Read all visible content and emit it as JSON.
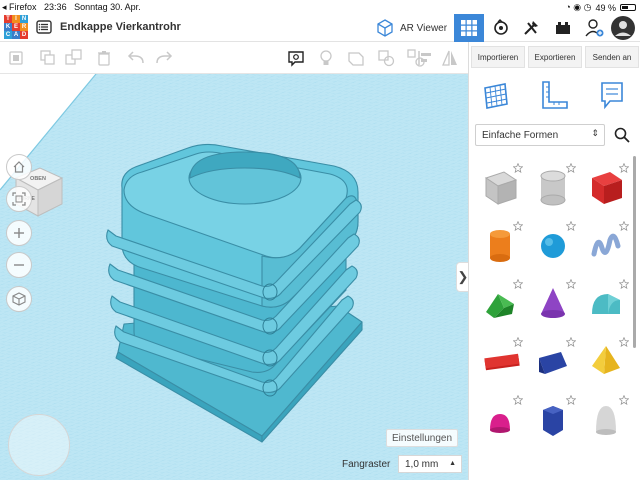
{
  "status_bar": {
    "back_app": "◂ Firefox",
    "time": "23:36",
    "date": "Sonntag 30. Apr.",
    "signal_icons": [
      "cellular-icon",
      "wifi-icon",
      "lock-rotation-icon",
      "alarm-icon"
    ],
    "battery": "49 %",
    "battery_level": 0.49
  },
  "logo": {
    "letters": [
      "T",
      "I",
      "N",
      "K",
      "E",
      "R",
      "C",
      "A",
      "D"
    ],
    "colors": [
      "#e53c2e",
      "#f28e1c",
      "#2fa0d8",
      "#3b7dc9",
      "#e53c2e",
      "#f28e1c",
      "#2fa0d8",
      "#3b7dc9",
      "#e53c2e"
    ]
  },
  "topbar": {
    "menu_icon": "design-list-icon",
    "design_title": "Endkappe Vierkantrohr",
    "ar_viewer_label": "AR Viewer",
    "view_icons": [
      "3d-view-icon",
      "codeblocks-icon",
      "circuits-icon",
      "blocks-icon",
      "user-add-icon",
      "avatar"
    ]
  },
  "edit_toolbar": {
    "icons": [
      "copy-workplane-icon",
      "copy-icon",
      "duplicate-icon",
      "delete-icon",
      "undo-icon",
      "redo-icon",
      "notes-icon",
      "light-icon",
      "shape-hide-icon",
      "group-icon",
      "ungroup-icon",
      "align-icon",
      "mirror-icon"
    ]
  },
  "right_panel": {
    "import_label": "Importieren",
    "export_label": "Exportieren",
    "send_label": "Senden an",
    "tools": [
      "workplane-tool-icon",
      "ruler-tool-icon",
      "notes-tool-icon"
    ],
    "shape_category": "Einfache Formen",
    "shapes": [
      "box-hole-icon",
      "cylinder-hole-icon",
      "box-icon",
      "cylinder-icon",
      "sphere-icon",
      "scribble-icon",
      "roof-icon",
      "cone-icon",
      "round-roof-icon",
      "text-icon",
      "wedge-icon",
      "pyramid-icon",
      "half-sphere-icon",
      "polygon-icon",
      "paraboloid-icon"
    ]
  },
  "workplane": {
    "view_cube_top": "OBEN",
    "view_cube_front": "VORNE",
    "nav_controls": [
      "home-view-icon",
      "fit-view-icon",
      "zoom-in-icon",
      "zoom-out-icon",
      "ortho-view-icon"
    ],
    "settings_label": "Einstellungen",
    "grid_label": "Fangraster",
    "grid_value": "1,0 mm",
    "grid_color": "#8ecfe8",
    "model_color": "#5fc4d8",
    "accent_color": "#3b87d8"
  }
}
